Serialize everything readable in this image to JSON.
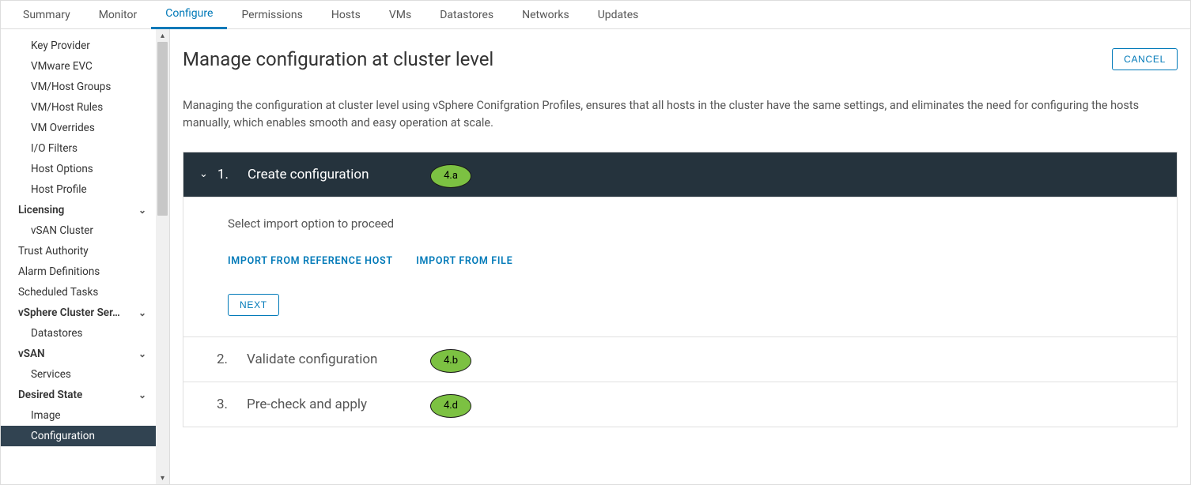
{
  "tabs": [
    "Summary",
    "Monitor",
    "Configure",
    "Permissions",
    "Hosts",
    "VMs",
    "Datastores",
    "Networks",
    "Updates"
  ],
  "active_tab_index": 2,
  "sidebar": {
    "items": [
      {
        "type": "item",
        "label": "Key Provider"
      },
      {
        "type": "item",
        "label": "VMware EVC"
      },
      {
        "type": "item",
        "label": "VM/Host Groups"
      },
      {
        "type": "item",
        "label": "VM/Host Rules"
      },
      {
        "type": "item",
        "label": "VM Overrides"
      },
      {
        "type": "item",
        "label": "I/O Filters"
      },
      {
        "type": "item",
        "label": "Host Options"
      },
      {
        "type": "item",
        "label": "Host Profile"
      },
      {
        "type": "group",
        "label": "Licensing"
      },
      {
        "type": "item",
        "label": "vSAN Cluster"
      },
      {
        "type": "top",
        "label": "Trust Authority"
      },
      {
        "type": "top",
        "label": "Alarm Definitions"
      },
      {
        "type": "top",
        "label": "Scheduled Tasks"
      },
      {
        "type": "group",
        "label": "vSphere Cluster Ser…"
      },
      {
        "type": "item",
        "label": "Datastores"
      },
      {
        "type": "group",
        "label": "vSAN"
      },
      {
        "type": "item",
        "label": "Services"
      },
      {
        "type": "group",
        "label": "Desired State"
      },
      {
        "type": "item",
        "label": "Image"
      },
      {
        "type": "item",
        "label": "Configuration",
        "selected": true
      }
    ]
  },
  "main": {
    "title": "Manage configuration at cluster level",
    "cancel_label": "CANCEL",
    "description": "Managing the configuration at cluster level using vSphere Conifgration Profiles, ensures that all hosts in the cluster have the same settings, and eliminates the need for configuring the hosts manually, which enables smooth and easy operation at scale.",
    "steps": [
      {
        "num": "1.",
        "title": "Create configuration",
        "expanded": true,
        "anno": "4.a"
      },
      {
        "num": "2.",
        "title": "Validate configuration",
        "expanded": false,
        "anno": "4.b"
      },
      {
        "num": "3.",
        "title": "Pre-check and apply",
        "expanded": false,
        "anno": "4.d"
      }
    ],
    "step1": {
      "instruction": "Select import option to proceed",
      "import_host": "IMPORT FROM REFERENCE HOST",
      "import_file": "IMPORT FROM FILE",
      "next": "NEXT"
    }
  }
}
